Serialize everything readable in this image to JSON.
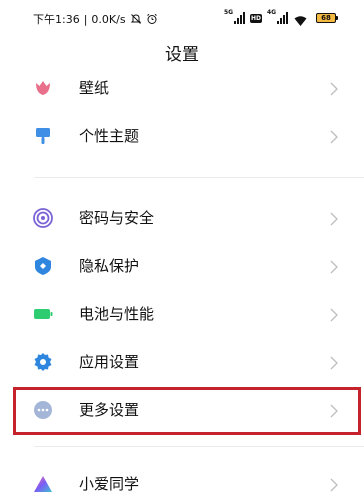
{
  "status_bar": {
    "time": "下午1:36",
    "speed": "0.0K/s",
    "battery_level": "68",
    "battery_color": "#f4b942",
    "network_labels": [
      "5G",
      "4G"
    ],
    "hd_label": "HD"
  },
  "page": {
    "title": "设置"
  },
  "settings": {
    "group1": [
      {
        "label": "壁纸",
        "icon": "wallpaper-tulip-icon",
        "color": "#e8708a"
      },
      {
        "label": "个性主题",
        "icon": "theme-brush-icon",
        "color": "#3f8fe6"
      }
    ],
    "group2": [
      {
        "label": "密码与安全",
        "icon": "password-security-icon",
        "color": "#7b63d6"
      },
      {
        "label": "隐私保护",
        "icon": "privacy-shield-icon",
        "color": "#2e86de"
      },
      {
        "label": "电池与性能",
        "icon": "battery-performance-icon",
        "color": "#2ecc71"
      },
      {
        "label": "应用设置",
        "icon": "app-settings-gear-icon",
        "color": "#2e86de"
      },
      {
        "label": "更多设置",
        "icon": "more-settings-icon",
        "color": "#a4b6d8"
      }
    ],
    "group3": [
      {
        "label": "小爱同学",
        "icon": "xiaoai-icon",
        "color": "#7a5cf5"
      }
    ]
  },
  "highlight_color": "#c4232b"
}
